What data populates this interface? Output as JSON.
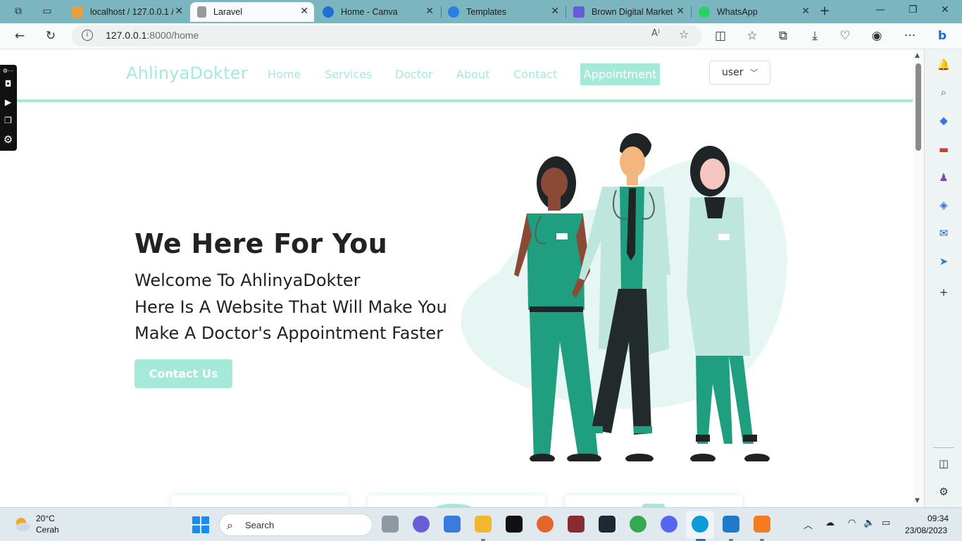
{
  "browser": {
    "tabs": [
      {
        "label": "localhost / 127.0.0.1 / ",
        "icon": "phpmyadmin-icon",
        "active": false
      },
      {
        "label": "Laravel",
        "icon": "page-icon",
        "active": true
      },
      {
        "label": "Home - Canva",
        "icon": "canva-icon",
        "active": false
      },
      {
        "label": "Templates",
        "icon": "canva-icon",
        "active": false
      },
      {
        "label": "Brown Digital Market",
        "icon": "document-icon",
        "active": false
      },
      {
        "label": "WhatsApp",
        "icon": "whatsapp-icon",
        "active": false
      }
    ],
    "url_host": "127.0.0.1",
    "url_path": ":8000/home"
  },
  "site": {
    "brand": "AhlinyaDokter",
    "nav": [
      "Home",
      "Services",
      "Doctor",
      "About",
      "Contact"
    ],
    "appointment": "Appointment",
    "user_menu": "user",
    "accent_color": "#a5ead8"
  },
  "hero": {
    "title": "We Here For You",
    "lines": [
      "Welcome To AhlinyaDokter",
      "Here Is A Website That Will Make You",
      "Make A Doctor's Appointment Faster"
    ],
    "button": "Contact Us"
  },
  "taskbar": {
    "weather_temp": "20°C",
    "weather_cond": "Cerah",
    "search_placeholder": "Search",
    "time": "09:34",
    "date": "23/08/2023"
  }
}
